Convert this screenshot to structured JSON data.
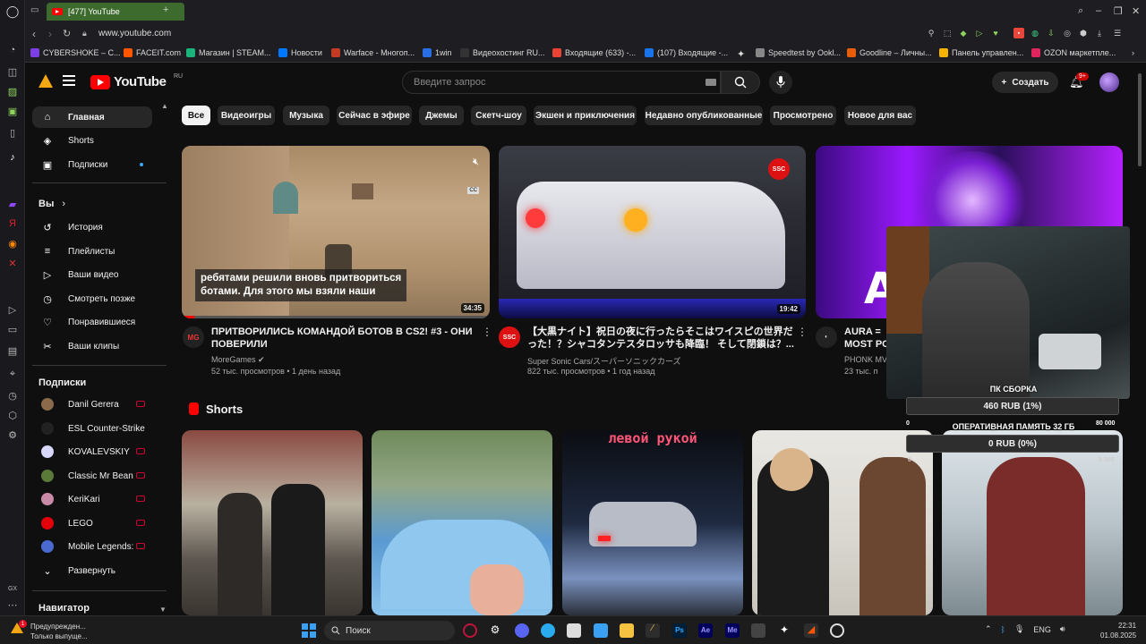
{
  "browser": {
    "tab_title": "[477] YouTube",
    "url": "www.youtube.com",
    "bookmarks": [
      {
        "label": "CYBERSHOKE – C...",
        "color": "#7b3fe4"
      },
      {
        "label": "FACEIT.com",
        "color": "#ff5500"
      },
      {
        "label": "Магазин | STEAM...",
        "color": "#1bb27b"
      },
      {
        "label": "Новости",
        "color": "#0077ff"
      },
      {
        "label": "Warface - Многоп...",
        "color": "#c23b22"
      },
      {
        "label": "1win",
        "color": "#2a6ee6"
      },
      {
        "label": "Видеохостинг RU...",
        "color": "#333333"
      },
      {
        "label": "Входящие (633) -...",
        "color": "#ea4335"
      },
      {
        "label": "(107) Входящие -...",
        "color": "#1a73e8"
      },
      {
        "label": "Speedtest by Ookl...",
        "color": "#888888"
      },
      {
        "label": "Goodline – Личны...",
        "color": "#e85d0c"
      },
      {
        "label": "Панель управлен...",
        "color": "#f4b400"
      },
      {
        "label": "OZON маркетпле...",
        "color": "#e0245e"
      }
    ]
  },
  "header": {
    "logo_text": "YouTube",
    "logo_region": "RU",
    "search_placeholder": "Введите запрос",
    "create_label": "Создать",
    "notif_count": "9+"
  },
  "sidebar": {
    "main": [
      {
        "label": "Главная",
        "icon": "home-icon",
        "glyph": "⌂"
      },
      {
        "label": "Shorts",
        "icon": "shorts-icon",
        "glyph": "◈"
      },
      {
        "label": "Подписки",
        "icon": "subscriptions-icon",
        "glyph": "▣"
      }
    ],
    "you_header": "Вы",
    "you": [
      {
        "label": "История",
        "icon": "history-icon",
        "glyph": "↺"
      },
      {
        "label": "Плейлисты",
        "icon": "playlists-icon",
        "glyph": "≡"
      },
      {
        "label": "Ваши видео",
        "icon": "your-videos-icon",
        "glyph": "▷"
      },
      {
        "label": "Смотреть позже",
        "icon": "watch-later-icon",
        "glyph": "◷"
      },
      {
        "label": "Понравившиеся",
        "icon": "like-icon",
        "glyph": "👍"
      },
      {
        "label": "Ваши клипы",
        "icon": "clips-icon",
        "glyph": "✂"
      }
    ],
    "subs_header": "Подписки",
    "subs": [
      {
        "label": "Danil Gerera",
        "color": "#8a6a4a"
      },
      {
        "label": "ESL Counter-Strike",
        "color": "#222222"
      },
      {
        "label": "KOVALEVSKIY",
        "color": "#d7d7ff"
      },
      {
        "label": "Classic Mr Bean",
        "color": "#5a7a3a"
      },
      {
        "label": "KeriKari",
        "color": "#c88aa6"
      },
      {
        "label": "LEGO",
        "color": "#e3000b"
      },
      {
        "label": "Mobile Legends: ...",
        "color": "#4a6ad0"
      }
    ],
    "expand_label": "Развернуть",
    "navigator_header": "Навигатор"
  },
  "chips": [
    "Все",
    "Видеоигры",
    "Музыка",
    "Сейчас в эфире",
    "Джемы",
    "Скетч-шоу",
    "Экшен и приключения",
    "Недавно опубликованные",
    "Просмотрено",
    "Новое для вас"
  ],
  "videos": [
    {
      "title_line1": "ПРИТВОРИЛИСЬ КОМАНДОЙ БОТОВ В CS2! #3 - ОНИ",
      "title_line2": "ПОВЕРИЛИ",
      "channel": "MoreGames",
      "meta": "52 тыс. просмотров • 1 день назад",
      "duration": "34:35",
      "subtitle_line1": "ребятами решили вновь притвориться",
      "subtitle_line2": "ботами. Для этого мы взяли наши",
      "cc_label": "CC"
    },
    {
      "title_line1": "【大黒ナイト】祝日の夜に行ったらそこはワイスピの世界だ",
      "title_line2": "った！？シャコタンテスタロッサも降臨！ そして閉鎖は？...",
      "channel": "Super Sonic Cars/スーパーソニックカーズ",
      "meta": "822 тыс. просмотров • 1 год назад",
      "duration": "19:42",
      "badge": "SSC"
    },
    {
      "title_line1": "AURA = ",
      "title_line2": "MOST PO",
      "channel": "PHONK MV",
      "meta": "23 тыс. п",
      "thumb_letter": "A"
    }
  ],
  "shorts": {
    "title": "Shorts",
    "overlay_text": "левой рукой"
  },
  "donation": {
    "goal1_title": "ПК СБОРКА",
    "goal1_value": "460 RUB (1%)",
    "goal1_min": "0",
    "goal2_title": "ОПЕРАТИВНАЯ ПАМЯТЬ 32 ГБ",
    "goal2_min": "0",
    "goal2_max": "80 000",
    "goal2_value": "0 RUB (0%)",
    "goal2_max_small": "9 000"
  },
  "taskbar": {
    "notif_title": "Предупрежден...",
    "notif_sub": "Только выпуще...",
    "notif_badge": "1",
    "search_label": "Поиск",
    "lang": "ENG",
    "time": "22:31",
    "date": "01.08.2025"
  }
}
